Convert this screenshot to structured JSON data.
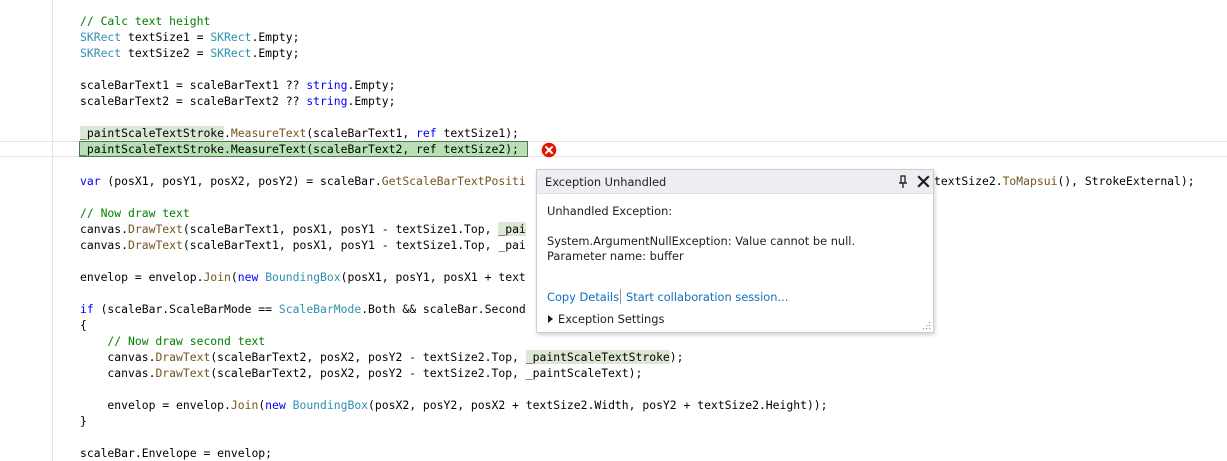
{
  "code": {
    "l1": "// Calc text height",
    "l2a": "SKRect",
    "l2b": " textSize1 = ",
    "l2c": "SKRect",
    "l2d": ".Empty;",
    "l3a": "SKRect",
    "l3b": " textSize2 = ",
    "l3c": "SKRect",
    "l3d": ".Empty;",
    "l5a": "scaleBarText1 = scaleBarText1 ?? ",
    "l5b": "string",
    "l5c": ".Empty;",
    "l6a": "scaleBarText2 = scaleBarText2 ?? ",
    "l6b": "string",
    "l6c": ".Empty;",
    "l8a": "_paintScaleTextStroke",
    "l8b": ".",
    "l8c": "MeasureText",
    "l8d": "(scaleBarText1, ",
    "l8e": "ref",
    "l8f": " textSize1);",
    "l9a": "_paintScaleTextStroke",
    "l9b": ".",
    "l9c": "MeasureText",
    "l9d": "(scaleBarText2, ",
    "l9e": "ref",
    "l9f": " textSize2);",
    "l11a": "var",
    "l11b": " (posX1, posY1, posX2, posY2) = scaleBar.",
    "l11c": "GetScaleBarTextPositi",
    "l11d": "textSize2.",
    "l11e": "ToMapsui",
    "l11f": "(), StrokeExternal);",
    "l13": "// Now draw text",
    "l14a": "canvas.",
    "l14b": "DrawText",
    "l14c": "(scaleBarText1, posX1, posY1 - textSize1.Top, ",
    "l14d": "_pai",
    "l15a": "canvas.",
    "l15b": "DrawText",
    "l15c": "(scaleBarText1, posX1, posY1 - textSize1.Top, _pai",
    "l17a": "envelop = envelop.",
    "l17b": "Join",
    "l17c": "(",
    "l17d": "new",
    "l17e": " ",
    "l17f": "BoundingBox",
    "l17g": "(posX1, posY1, posX1 + text",
    "l19a": "if",
    "l19b": " (scaleBar.ScaleBarMode == ",
    "l19c": "ScaleBarMode",
    "l19d": ".Both && scaleBar.Second",
    "l20": "{",
    "l21": "    // Now draw second text",
    "l22a": "    canvas.",
    "l22b": "DrawText",
    "l22c": "(scaleBarText2, posX2, posY2 - textSize2.Top, ",
    "l22d": "_paintScaleTextStroke",
    "l22e": ");",
    "l23a": "    canvas.",
    "l23b": "DrawText",
    "l23c": "(scaleBarText2, posX2, posY2 - textSize2.Top, _paintScaleText);",
    "l25a": "    envelop = envelop.",
    "l25b": "Join",
    "l25c": "(",
    "l25d": "new",
    "l25e": " ",
    "l25f": "BoundingBox",
    "l25g": "(posX2, posY2, posX2 + textSize2.Width, posY2 + textSize2.Height));",
    "l26": "}",
    "l28": "scaleBar.Envelope = envelop;"
  },
  "popup": {
    "title": "Exception Unhandled",
    "heading": "Unhandled Exception:",
    "message_line1": "System.ArgumentNullException: Value cannot be null.",
    "message_line2": "Parameter name: buffer",
    "copy_details": "Copy Details",
    "collab": "Start collaboration session...",
    "settings": "Exception Settings"
  },
  "icons": {
    "error": "error-circle-icon",
    "pin": "pin-icon",
    "close": "close-icon",
    "expand": "expand-arrow-icon",
    "grip": "resize-grip-icon"
  },
  "colors": {
    "comment": "#008000",
    "type": "#2b91af",
    "keyword": "#0000ff",
    "method": "#74531f",
    "link": "#0e70c0",
    "error": "#e51400"
  }
}
